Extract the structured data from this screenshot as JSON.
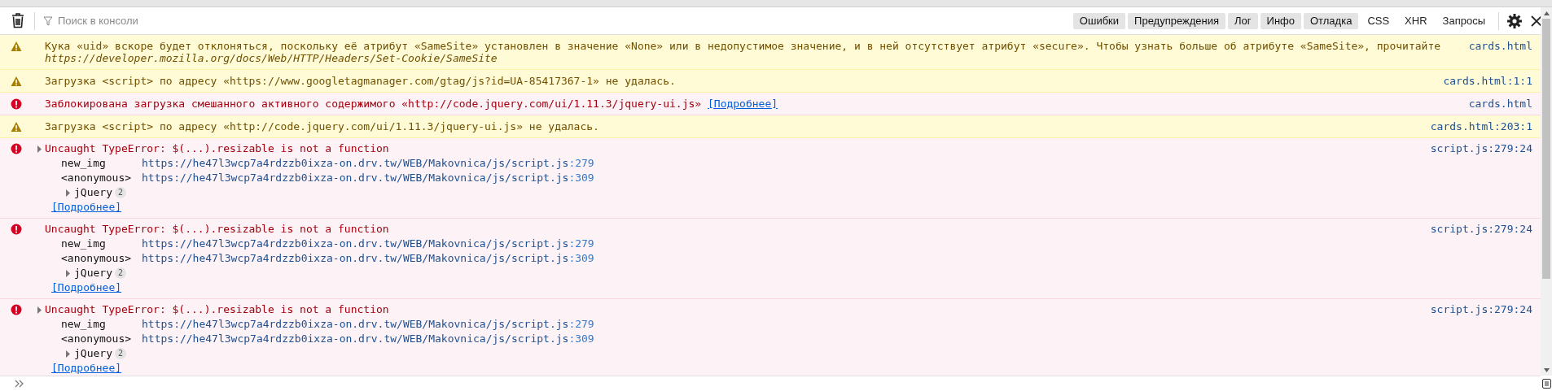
{
  "toolbar": {
    "search": {
      "placeholder": "Поиск в консоли"
    },
    "filters": [
      {
        "label": "Ошибки",
        "selected": true
      },
      {
        "label": "Предупреждения",
        "selected": true
      },
      {
        "label": "Лог",
        "selected": true
      },
      {
        "label": "Инфо",
        "selected": true
      },
      {
        "label": "Отладка",
        "selected": true
      },
      {
        "label": "CSS",
        "selected": false
      },
      {
        "label": "XHR",
        "selected": false
      },
      {
        "label": "Запросы",
        "selected": false
      }
    ]
  },
  "messages": [
    {
      "kind": "warning",
      "text": "Кука «uid» вскоре будет отклоняться, поскольку её атрибут «SameSite» установлен в значение «None» или в недопустимое значение, и в ней отсутствует атрибут «secure». Чтобы узнать больше об атрибуте «SameSite», прочитайте",
      "link_text": "https://developer.mozilla.org/docs/Web/HTTP/Headers/Set-Cookie/SameSite",
      "location": "cards.html"
    },
    {
      "kind": "warning",
      "text": "Загрузка <script> по адресу «https://www.googletagmanager.com/gtag/js?id=UA-85417367-1» не удалась.",
      "location": "cards.html:1:1"
    },
    {
      "kind": "error",
      "text": "Заблокирована загрузка смешанного активного содержимого «http://code.jquery.com/ui/1.11.3/jquery-ui.js»",
      "more": "[Подробнее]",
      "location": "cards.html"
    },
    {
      "kind": "warning",
      "text": "Загрузка <script> по адресу «http://code.jquery.com/ui/1.11.3/jquery-ui.js» не удалась.",
      "location": "cards.html:203:1"
    },
    {
      "kind": "exception",
      "text": "Uncaught TypeError: $(...).resizable is not a function",
      "location": "script.js:279:24",
      "expanded": false,
      "frames": [
        {
          "function": "new_img",
          "url": "https://he47l3wcp7a4rdzzb0ixza-on.drv.tw/WEB/Makovnica/js/script.js",
          "line": ":279"
        },
        {
          "function": "<anonymous>",
          "url": "https://he47l3wcp7a4rdzzb0ixza-on.drv.tw/WEB/Makovnica/js/script.js",
          "line": ":309"
        }
      ],
      "group": {
        "label": "jQuery",
        "count": "2",
        "expanded": false
      },
      "more": "[Подробнее]"
    },
    {
      "kind": "exception",
      "text": "Uncaught TypeError: $(...).resizable is not a function",
      "location": "script.js:279:24",
      "frames": [
        {
          "function": "new_img",
          "url": "https://he47l3wcp7a4rdzzb0ixza-on.drv.tw/WEB/Makovnica/js/script.js",
          "line": ":279"
        },
        {
          "function": "<anonymous>",
          "url": "https://he47l3wcp7a4rdzzb0ixza-on.drv.tw/WEB/Makovnica/js/script.js",
          "line": ":309"
        }
      ],
      "group": {
        "label": "jQuery",
        "count": "2",
        "expanded": false
      },
      "more": "[Подробнее]"
    },
    {
      "kind": "exception",
      "text": "Uncaught TypeError: $(...).resizable is not a function",
      "location": "script.js:279:24",
      "expanded": false,
      "frames": [
        {
          "function": "new_img",
          "url": "https://he47l3wcp7a4rdzzb0ixza-on.drv.tw/WEB/Makovnica/js/script.js",
          "line": ":279"
        },
        {
          "function": "<anonymous>",
          "url": "https://he47l3wcp7a4rdzzb0ixza-on.drv.tw/WEB/Makovnica/js/script.js",
          "line": ":309"
        }
      ],
      "group": {
        "label": "jQuery",
        "count": "2",
        "expanded": false
      },
      "more": "[Подробнее]"
    }
  ]
}
